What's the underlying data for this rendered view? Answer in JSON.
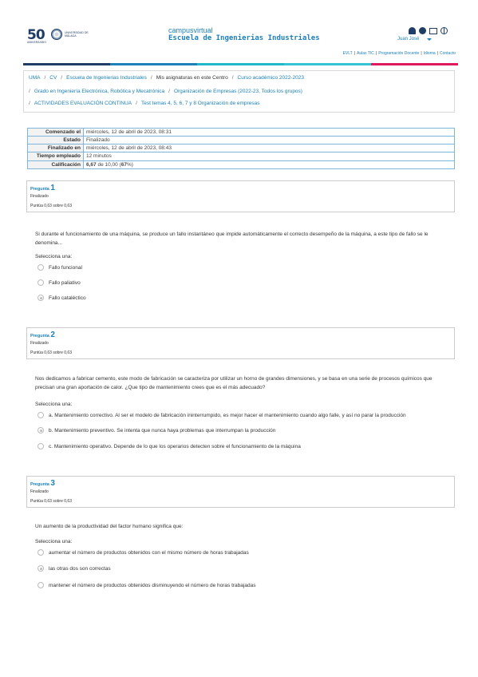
{
  "header": {
    "logo_text": "50",
    "logo_subtext": "ANIVERSARIO",
    "university_text": "UNIVERSIDAD DE MÁLAGA",
    "site_small": "campusvirtual",
    "site_big": "Escuela de Ingenierias Industriales",
    "user": "Juan José",
    "links": [
      "EVLT",
      "Aulas TIC",
      "Programación Docente",
      "Idioma",
      "Contacto"
    ],
    "colorbar": [
      "#1f3d66",
      "#1d80b8",
      "#1fb8c8",
      "#34c3d4",
      "#e0185c"
    ]
  },
  "breadcrumb": {
    "line1": [
      "UMA",
      "CV",
      "Escuela de Ingenierias Industriales",
      "Mis asignaturas en este Centro",
      "Curso académico 2022-2023"
    ],
    "line2": [
      "Grado en Ingeniería Electrónica, Robótica y Mecatrónica",
      "Organización de Empresas (2022-23, Todos los grupos)"
    ],
    "line3": [
      "ACTIVIDADES EVALUACIÓN CONTINUA",
      "Test temas 4, 5, 6, 7 y 8 Organización de empresas"
    ]
  },
  "summary": {
    "rows": [
      {
        "k": "Comenzado el",
        "v": "miércoles, 12 de abril de 2023, 08:31"
      },
      {
        "k": "Estado",
        "v": "Finalizado"
      },
      {
        "k": "Finalizado en",
        "v": "miércoles, 12 de abril de 2023, 08:43"
      },
      {
        "k": "Tiempo empleado",
        "v": "12 minutos"
      }
    ],
    "grade_label": "Calificación",
    "grade_value": "6,67",
    "grade_of": "de 10,00 (",
    "grade_pct": "67",
    "grade_end": "%)"
  },
  "questions": [
    {
      "label": "Pregunta",
      "num": "1",
      "state": "Finalizado",
      "mark": "Puntúa 0,63 sobre 0,63",
      "text": "Si durante el funcionamiento de una máquina, se produce un fallo instantáneo que impide automáticamente el correcto desempeño de la máquina, a este tipo de fallo se le denomina...",
      "prompt": "Selecciona una:",
      "options": [
        {
          "label": "Fallo funcional",
          "selected": false
        },
        {
          "label": "Fallo paliativo",
          "selected": false
        },
        {
          "label": "Fallo cataléctico",
          "selected": true
        }
      ]
    },
    {
      "label": "Pregunta",
      "num": "2",
      "state": "Finalizado",
      "mark": "Puntúa 0,63 sobre 0,63",
      "text": "Nos dedicamos a fabricar cemento, este modo de fabricación se caracteriza por utilizar un horno de grandes dimensiones, y se basa en una serie de procesos químicos que precisan una gran aportación de calor. ¿Que tipo de mantenimiento crees que es el más adecuado?",
      "prompt": "Selecciona una:",
      "options": [
        {
          "label": "a. Mantenimiento correctivo. Al ser el modelo de fabricación ininterrumpido, es mejor hacer el mantenimiento cuando algo falle, y así no parar la producción",
          "selected": false
        },
        {
          "label": "b. Mantenimiento preventivo. Se intenta que nunca haya problemas que interrumpan la producción",
          "selected": true
        },
        {
          "label": "c. Mantenimiento operativo. Depende de lo que los operarios detecten sobre el funcionamiento de la máquina",
          "selected": false
        }
      ]
    },
    {
      "label": "Pregunta",
      "num": "3",
      "state": "Finalizado",
      "mark": "Puntúa 0,63 sobre 0,63",
      "text": "Un aumento de la productividad del factor humano significa que:",
      "prompt": "Selecciona una:",
      "options": [
        {
          "label": "aumentar el número de productos obtenidos con el mismo número de horas trabajadas",
          "selected": false
        },
        {
          "label": "las otras dos son correctas",
          "selected": true
        },
        {
          "label": "mantener el número de productos obtenidos disminuyendo el número de horas trabajadas",
          "selected": false
        }
      ]
    }
  ]
}
